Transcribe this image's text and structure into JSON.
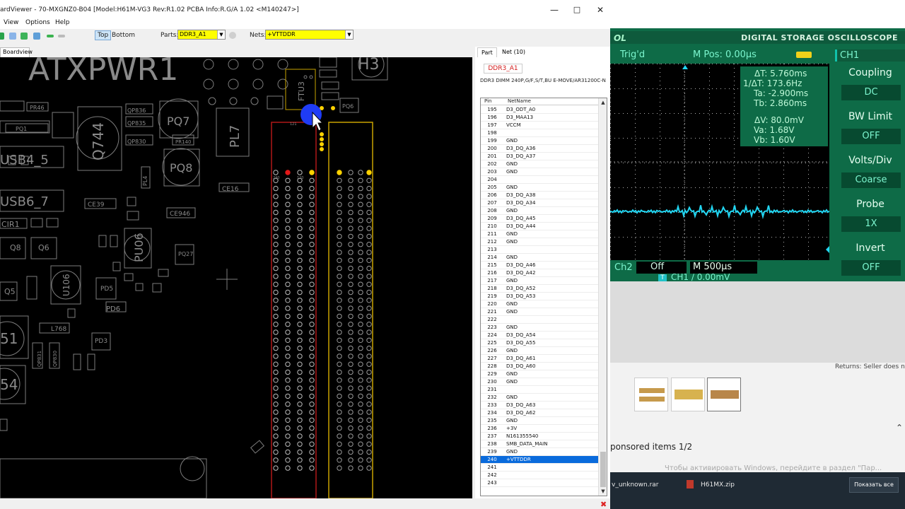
{
  "boardviewer": {
    "title": "ardViewer - 70-MXGNZ0-B04 [Model:H61M-VG3 Rev:R1.02 PCBA Info:R.G/A 1.02 <M140247>]",
    "menu": [
      "View",
      "Options",
      "Help"
    ],
    "toolbar": {
      "top_label": "Top",
      "bottom_label": "Bottom",
      "parts_label": "Parts:",
      "parts_value": "DDR3_A1",
      "nets_label": "Nets:",
      "nets_value": "+VTTDDR"
    },
    "tab": "Boardview",
    "board_labels": {
      "atxpwr": "ATXPWR1",
      "h3": "H3",
      "pq7": "PQ7",
      "pq8": "PQ8",
      "pl7": "PL7",
      "q744": "Q744",
      "usb45": "USB4_5",
      "usb67": "USB6_7",
      "pu06": "PU06",
      "u106": "U106",
      "cir1": "CIR1",
      "q8": "Q8",
      "q6": "Q6",
      "q5": "Q5",
      "s1": "51",
      "s4": "54",
      "ce39": "CE39",
      "ce94": "CE946",
      "ce16": "CE16",
      "pd6": "PD6",
      "pd5": "PD5",
      "pd3": "PD3",
      "l768": "L768",
      "pq27": "PQ27",
      "pl4": "PL4",
      "ftu3": "FTU3",
      "pq6": "PQ6",
      "pr46": "PR46",
      "qp836": "QP836",
      "qp835": "QP835",
      "qp830": "QP830",
      "pq1": "PQ1",
      "pr140": "PR140",
      "qp831": "QP831",
      "qp830b": "QP830",
      "pin_top_left": "240",
      "pin_top_right": "120",
      "pin_bottom": "121"
    },
    "panel": {
      "tabs": [
        "Part",
        "Net (10)"
      ],
      "part_name": "DDR3_A1",
      "part_desc": "DDR3 DIMM 240P,G/F,S/T,BU E-MOVE/AR31200C-N",
      "columns": [
        "Pin",
        "NetName"
      ],
      "rows": [
        {
          "pin": "195",
          "net": "D3_ODT_A0"
        },
        {
          "pin": "196",
          "net": "D3_MAA13"
        },
        {
          "pin": "197",
          "net": "VCCM"
        },
        {
          "pin": "198",
          "net": ""
        },
        {
          "pin": "199",
          "net": "GND"
        },
        {
          "pin": "200",
          "net": "D3_DQ_A36"
        },
        {
          "pin": "201",
          "net": "D3_DQ_A37"
        },
        {
          "pin": "202",
          "net": "GND"
        },
        {
          "pin": "203",
          "net": "GND"
        },
        {
          "pin": "204",
          "net": ""
        },
        {
          "pin": "205",
          "net": "GND"
        },
        {
          "pin": "206",
          "net": "D3_DQ_A38"
        },
        {
          "pin": "207",
          "net": "D3_DQ_A34"
        },
        {
          "pin": "208",
          "net": "GND"
        },
        {
          "pin": "209",
          "net": "D3_DQ_A45"
        },
        {
          "pin": "210",
          "net": "D3_DQ_A44"
        },
        {
          "pin": "211",
          "net": "GND"
        },
        {
          "pin": "212",
          "net": "GND"
        },
        {
          "pin": "213",
          "net": ""
        },
        {
          "pin": "214",
          "net": "GND"
        },
        {
          "pin": "215",
          "net": "D3_DQ_A46"
        },
        {
          "pin": "216",
          "net": "D3_DQ_A42"
        },
        {
          "pin": "217",
          "net": "GND"
        },
        {
          "pin": "218",
          "net": "D3_DQ_A52"
        },
        {
          "pin": "219",
          "net": "D3_DQ_A53"
        },
        {
          "pin": "220",
          "net": "GND"
        },
        {
          "pin": "221",
          "net": "GND"
        },
        {
          "pin": "222",
          "net": ""
        },
        {
          "pin": "223",
          "net": "GND"
        },
        {
          "pin": "224",
          "net": "D3_DQ_A54"
        },
        {
          "pin": "225",
          "net": "D3_DQ_A55"
        },
        {
          "pin": "226",
          "net": "GND"
        },
        {
          "pin": "227",
          "net": "D3_DQ_A61"
        },
        {
          "pin": "228",
          "net": "D3_DQ_A60"
        },
        {
          "pin": "229",
          "net": "GND"
        },
        {
          "pin": "230",
          "net": "GND"
        },
        {
          "pin": "231",
          "net": ""
        },
        {
          "pin": "232",
          "net": "GND"
        },
        {
          "pin": "233",
          "net": "D3_DQ_A63"
        },
        {
          "pin": "234",
          "net": "D3_DQ_A62"
        },
        {
          "pin": "235",
          "net": "GND"
        },
        {
          "pin": "236",
          "net": "+3V"
        },
        {
          "pin": "237",
          "net": "N161355540"
        },
        {
          "pin": "238",
          "net": "SMB_DATA_MAIN"
        },
        {
          "pin": "239",
          "net": "GND"
        },
        {
          "pin": "240",
          "net": "+VTTDDR",
          "selected": true
        },
        {
          "pin": "241",
          "net": ""
        },
        {
          "pin": "242",
          "net": ""
        },
        {
          "pin": "243",
          "net": ""
        }
      ]
    }
  },
  "oscilloscope": {
    "header_left": "OL",
    "header_right": "DIGITAL STORAGE OSCILLOSCOPE",
    "trig_status": "Trig'd",
    "mpos": "M Pos: 0.00µs",
    "cursor": {
      "dT": "ΔT:  5.760ms",
      "inv_dT": "1/ΔT: 173.6Hz",
      "Ta": "Ta:  -2.900ms",
      "Tb": "Tb:  2.860ms",
      "dV": "ΔV:  80.0mV",
      "Va": "Va:  1.68V",
      "Vb": "Vb:  1.60V"
    },
    "ch2": "Ch2",
    "ch2_state": "Off",
    "timebase": "M 500µs",
    "trigger": "CH1  ∕  0.00mV",
    "menu_title": "CH1",
    "menu": [
      {
        "title": "Coupling",
        "value": "DC"
      },
      {
        "title": "BW  Limit",
        "value": "OFF"
      },
      {
        "title": "Volts/Div",
        "value": "Coarse"
      },
      {
        "title": "Probe",
        "value": "1X"
      },
      {
        "title": "Invert",
        "value": "OFF"
      }
    ]
  },
  "page": {
    "returns": "Returns:      Seller does n",
    "sponsored": "ponsored items  1/2",
    "taskbar_file1": "v_unknown.rar",
    "taskbar_file2": "H61MX.zip",
    "taskbar_button": "Показать все",
    "win_watermark": "Чтобы активировать Windows, перейдите в раздел \"Пар..."
  },
  "colors": {
    "board_bg": "#000000",
    "board_silk": "#8a8a8a",
    "highlight_net": "#ffd200",
    "selected_row": "#0a6bdc",
    "trace": "#22d6f2",
    "scope_bg": "#0e6b47"
  }
}
